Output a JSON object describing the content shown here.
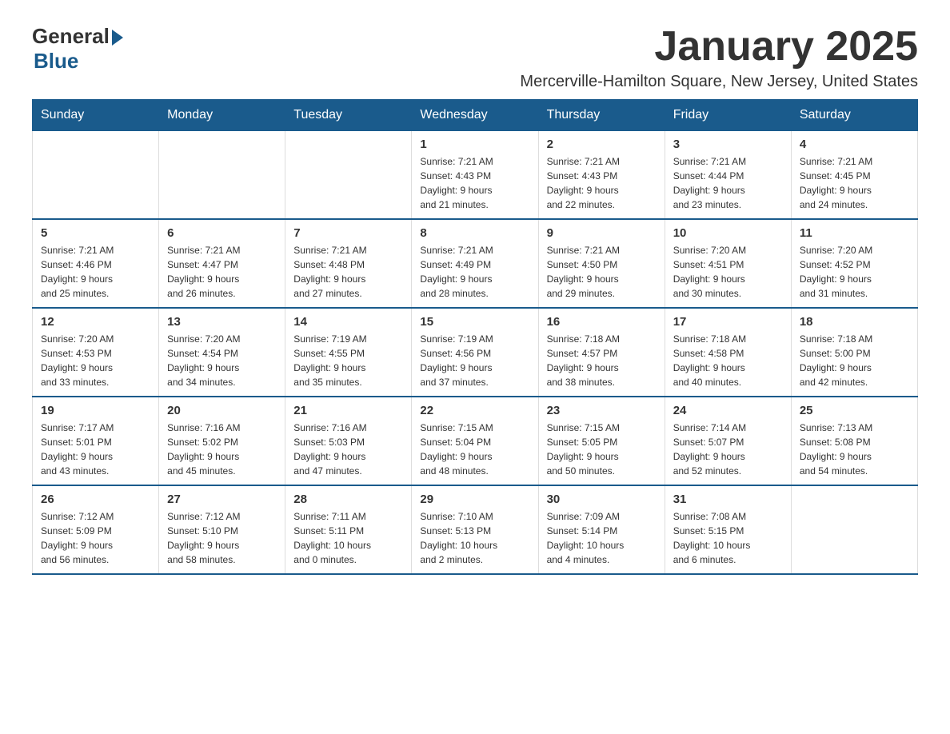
{
  "logo": {
    "general": "General",
    "blue": "Blue"
  },
  "title": "January 2025",
  "location": "Mercerville-Hamilton Square, New Jersey, United States",
  "days_of_week": [
    "Sunday",
    "Monday",
    "Tuesday",
    "Wednesday",
    "Thursday",
    "Friday",
    "Saturday"
  ],
  "weeks": [
    [
      {
        "day": "",
        "info": ""
      },
      {
        "day": "",
        "info": ""
      },
      {
        "day": "",
        "info": ""
      },
      {
        "day": "1",
        "info": "Sunrise: 7:21 AM\nSunset: 4:43 PM\nDaylight: 9 hours\nand 21 minutes."
      },
      {
        "day": "2",
        "info": "Sunrise: 7:21 AM\nSunset: 4:43 PM\nDaylight: 9 hours\nand 22 minutes."
      },
      {
        "day": "3",
        "info": "Sunrise: 7:21 AM\nSunset: 4:44 PM\nDaylight: 9 hours\nand 23 minutes."
      },
      {
        "day": "4",
        "info": "Sunrise: 7:21 AM\nSunset: 4:45 PM\nDaylight: 9 hours\nand 24 minutes."
      }
    ],
    [
      {
        "day": "5",
        "info": "Sunrise: 7:21 AM\nSunset: 4:46 PM\nDaylight: 9 hours\nand 25 minutes."
      },
      {
        "day": "6",
        "info": "Sunrise: 7:21 AM\nSunset: 4:47 PM\nDaylight: 9 hours\nand 26 minutes."
      },
      {
        "day": "7",
        "info": "Sunrise: 7:21 AM\nSunset: 4:48 PM\nDaylight: 9 hours\nand 27 minutes."
      },
      {
        "day": "8",
        "info": "Sunrise: 7:21 AM\nSunset: 4:49 PM\nDaylight: 9 hours\nand 28 minutes."
      },
      {
        "day": "9",
        "info": "Sunrise: 7:21 AM\nSunset: 4:50 PM\nDaylight: 9 hours\nand 29 minutes."
      },
      {
        "day": "10",
        "info": "Sunrise: 7:20 AM\nSunset: 4:51 PM\nDaylight: 9 hours\nand 30 minutes."
      },
      {
        "day": "11",
        "info": "Sunrise: 7:20 AM\nSunset: 4:52 PM\nDaylight: 9 hours\nand 31 minutes."
      }
    ],
    [
      {
        "day": "12",
        "info": "Sunrise: 7:20 AM\nSunset: 4:53 PM\nDaylight: 9 hours\nand 33 minutes."
      },
      {
        "day": "13",
        "info": "Sunrise: 7:20 AM\nSunset: 4:54 PM\nDaylight: 9 hours\nand 34 minutes."
      },
      {
        "day": "14",
        "info": "Sunrise: 7:19 AM\nSunset: 4:55 PM\nDaylight: 9 hours\nand 35 minutes."
      },
      {
        "day": "15",
        "info": "Sunrise: 7:19 AM\nSunset: 4:56 PM\nDaylight: 9 hours\nand 37 minutes."
      },
      {
        "day": "16",
        "info": "Sunrise: 7:18 AM\nSunset: 4:57 PM\nDaylight: 9 hours\nand 38 minutes."
      },
      {
        "day": "17",
        "info": "Sunrise: 7:18 AM\nSunset: 4:58 PM\nDaylight: 9 hours\nand 40 minutes."
      },
      {
        "day": "18",
        "info": "Sunrise: 7:18 AM\nSunset: 5:00 PM\nDaylight: 9 hours\nand 42 minutes."
      }
    ],
    [
      {
        "day": "19",
        "info": "Sunrise: 7:17 AM\nSunset: 5:01 PM\nDaylight: 9 hours\nand 43 minutes."
      },
      {
        "day": "20",
        "info": "Sunrise: 7:16 AM\nSunset: 5:02 PM\nDaylight: 9 hours\nand 45 minutes."
      },
      {
        "day": "21",
        "info": "Sunrise: 7:16 AM\nSunset: 5:03 PM\nDaylight: 9 hours\nand 47 minutes."
      },
      {
        "day": "22",
        "info": "Sunrise: 7:15 AM\nSunset: 5:04 PM\nDaylight: 9 hours\nand 48 minutes."
      },
      {
        "day": "23",
        "info": "Sunrise: 7:15 AM\nSunset: 5:05 PM\nDaylight: 9 hours\nand 50 minutes."
      },
      {
        "day": "24",
        "info": "Sunrise: 7:14 AM\nSunset: 5:07 PM\nDaylight: 9 hours\nand 52 minutes."
      },
      {
        "day": "25",
        "info": "Sunrise: 7:13 AM\nSunset: 5:08 PM\nDaylight: 9 hours\nand 54 minutes."
      }
    ],
    [
      {
        "day": "26",
        "info": "Sunrise: 7:12 AM\nSunset: 5:09 PM\nDaylight: 9 hours\nand 56 minutes."
      },
      {
        "day": "27",
        "info": "Sunrise: 7:12 AM\nSunset: 5:10 PM\nDaylight: 9 hours\nand 58 minutes."
      },
      {
        "day": "28",
        "info": "Sunrise: 7:11 AM\nSunset: 5:11 PM\nDaylight: 10 hours\nand 0 minutes."
      },
      {
        "day": "29",
        "info": "Sunrise: 7:10 AM\nSunset: 5:13 PM\nDaylight: 10 hours\nand 2 minutes."
      },
      {
        "day": "30",
        "info": "Sunrise: 7:09 AM\nSunset: 5:14 PM\nDaylight: 10 hours\nand 4 minutes."
      },
      {
        "day": "31",
        "info": "Sunrise: 7:08 AM\nSunset: 5:15 PM\nDaylight: 10 hours\nand 6 minutes."
      },
      {
        "day": "",
        "info": ""
      }
    ]
  ]
}
